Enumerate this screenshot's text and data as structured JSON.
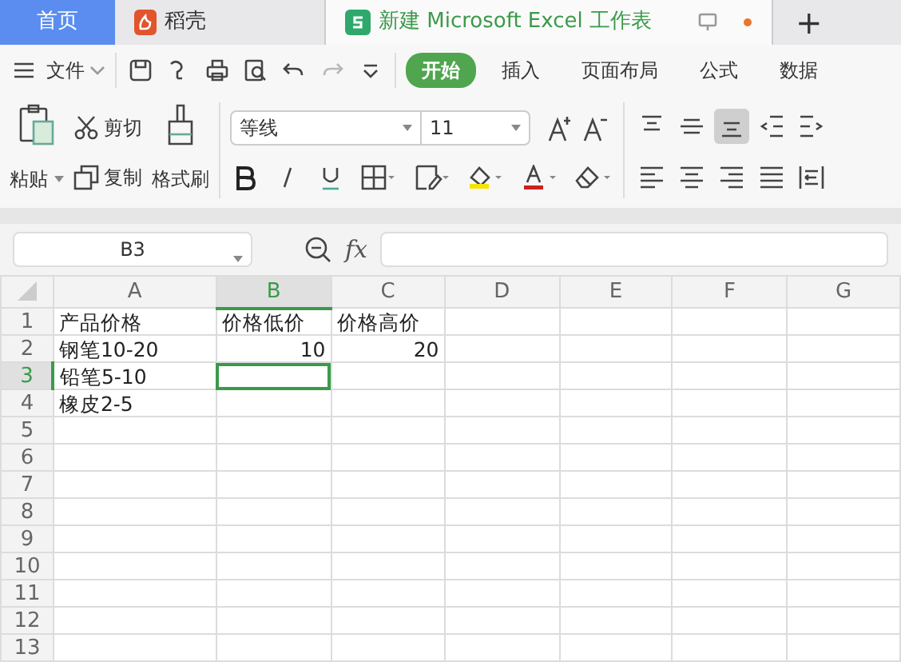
{
  "tabs": [
    {
      "kind": "home",
      "label": "首页",
      "selected": false
    },
    {
      "kind": "docer",
      "label": "稻壳",
      "selected": false
    },
    {
      "kind": "sheet",
      "label": "新建 Microsoft Excel 工作表",
      "selected": true
    }
  ],
  "new_tab": "+",
  "menu": {
    "file": "文件",
    "quick_tools": [
      {
        "kind": "save",
        "disabled": false
      },
      {
        "kind": "cursor",
        "disabled": false
      },
      {
        "kind": "print",
        "disabled": false
      },
      {
        "kind": "preview",
        "disabled": false
      },
      {
        "kind": "undo",
        "disabled": false
      },
      {
        "kind": "redo",
        "disabled": true
      },
      {
        "kind": "more",
        "disabled": false
      }
    ],
    "tabs": [
      {
        "label": "开始",
        "selected": true
      },
      {
        "label": "插入",
        "selected": false
      },
      {
        "label": "页面布局",
        "selected": false
      },
      {
        "label": "公式",
        "selected": false
      },
      {
        "label": "数据",
        "selected": false
      }
    ]
  },
  "ribbon": {
    "paste": "粘贴",
    "cut": "剪切",
    "copy": "复制",
    "format_painter": "格式刷",
    "font_name": "等线",
    "font_size": "11",
    "align_tools": [
      {
        "kind": "top",
        "selected": false
      },
      {
        "kind": "middle",
        "selected": false
      },
      {
        "kind": "bottom",
        "selected": true
      },
      {
        "kind": "outdent",
        "selected": false
      },
      {
        "kind": "indent",
        "selected": false
      },
      {
        "kind": "left",
        "selected": false
      },
      {
        "kind": "center",
        "selected": false
      },
      {
        "kind": "right",
        "selected": false
      },
      {
        "kind": "justify",
        "selected": false
      },
      {
        "kind": "distribute",
        "selected": false
      }
    ]
  },
  "name_box": "B3",
  "formula_label": "fx",
  "columns": [
    {
      "label": "A",
      "selected": false
    },
    {
      "label": "B",
      "selected": true
    },
    {
      "label": "C",
      "selected": false
    },
    {
      "label": "D",
      "selected": false
    },
    {
      "label": "E",
      "selected": false
    },
    {
      "label": "F",
      "selected": false
    },
    {
      "label": "G",
      "selected": false
    }
  ],
  "rows": [
    {
      "number": "1",
      "selected": false,
      "cells": [
        {
          "kind": "text",
          "text": "产品价格"
        },
        {
          "kind": "text",
          "text": "价格低价"
        },
        {
          "kind": "text",
          "text": "价格高价"
        }
      ]
    },
    {
      "number": "2",
      "selected": false,
      "cells": [
        {
          "kind": "text",
          "text": "钢笔10-20"
        },
        {
          "kind": "number",
          "text": "10"
        },
        {
          "kind": "number",
          "text": "20"
        }
      ]
    },
    {
      "number": "3",
      "selected": true,
      "cells": [
        {
          "kind": "text",
          "text": "铅笔5-10"
        }
      ]
    },
    {
      "number": "4",
      "selected": false,
      "cells": [
        {
          "kind": "text",
          "text": "橡皮2-5"
        }
      ]
    },
    {
      "number": "5",
      "selected": false
    },
    {
      "number": "6",
      "selected": false
    },
    {
      "number": "7",
      "selected": false
    },
    {
      "number": "8",
      "selected": false
    },
    {
      "number": "9",
      "selected": false
    },
    {
      "number": "10",
      "selected": false
    },
    {
      "number": "11",
      "selected": false
    },
    {
      "number": "12",
      "selected": false
    },
    {
      "number": "13",
      "selected": false
    }
  ]
}
